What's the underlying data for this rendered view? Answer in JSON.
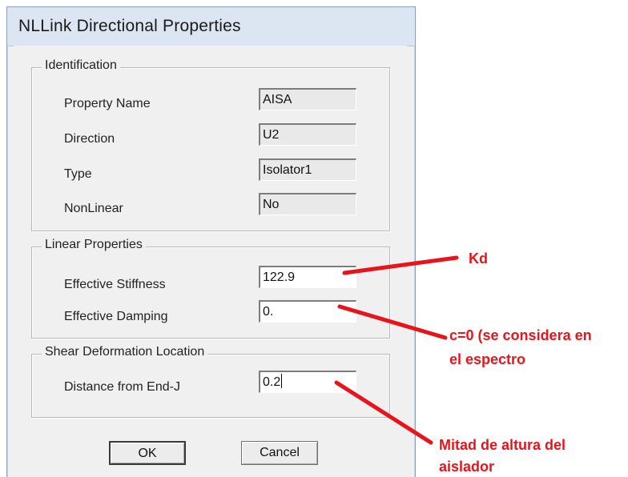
{
  "window": {
    "title": "NLLink Directional Properties"
  },
  "identification": {
    "legend": "Identification",
    "property_name_label": "Property Name",
    "property_name_value": "AISA",
    "direction_label": "Direction",
    "direction_value": "U2",
    "type_label": "Type",
    "type_value": "Isolator1",
    "nonlinear_label": "NonLinear",
    "nonlinear_value": "No"
  },
  "linear_properties": {
    "legend": "Linear Properties",
    "effective_stiffness_label": "Effective Stiffness",
    "effective_stiffness_value": "122.9",
    "effective_damping_label": "Effective Damping",
    "effective_damping_value": "0."
  },
  "shear_deformation": {
    "legend": "Shear Deformation Location",
    "distance_label": "Distance from End-J",
    "distance_value": "0.2"
  },
  "buttons": {
    "ok_label": "OK",
    "cancel_label": "Cancel"
  },
  "annotations": {
    "kd": "Kd",
    "damping_line1": "c=0 (se considera en",
    "damping_line2": "el espectro",
    "distance_line1": "Mitad de altura del",
    "distance_line2": "aislador",
    "color": "#e8141c"
  },
  "colors": {
    "titlebar": "#dce6f3",
    "dialog_bg": "#f0f0f0",
    "annotation": "#e8141c"
  }
}
